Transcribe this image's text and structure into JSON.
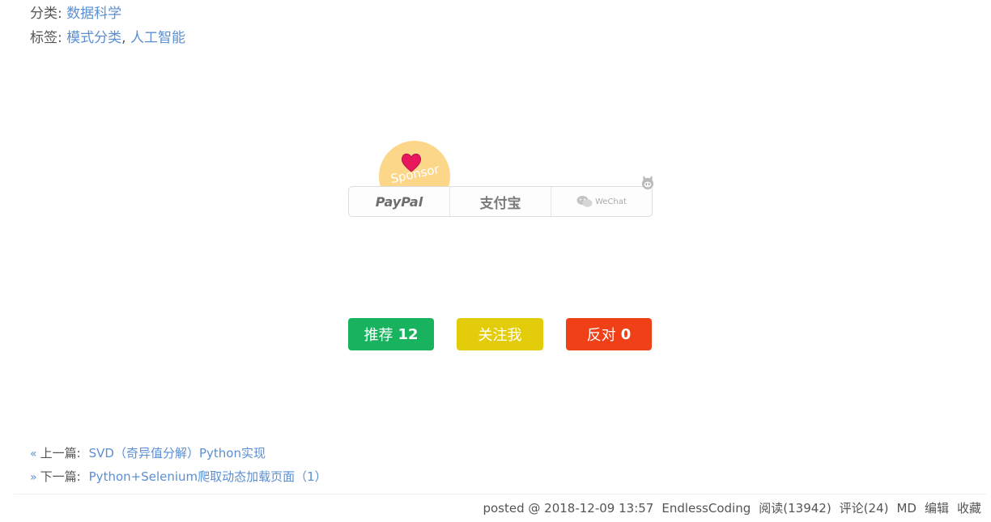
{
  "meta": {
    "category_label": "分类:",
    "category_value": "数据科学",
    "tag_label": "标签:",
    "tag_1": "模式分类",
    "tag_sep": ",",
    "tag_2": "人工智能"
  },
  "sponsor": {
    "badge_text": "Sponsor",
    "paypal": "PayPal",
    "alipay": "支付宝",
    "wechat": "WeChat",
    "heart_color": "#e8175d"
  },
  "votes": {
    "recommend_label": "推荐",
    "recommend_count": "12",
    "follow_label": "关注我",
    "oppose_label": "反对",
    "oppose_count": "0",
    "colors": {
      "recommend": "#19b35f",
      "follow": "#e3cd0b",
      "oppose": "#ef4018"
    }
  },
  "nav": {
    "prev_arrow": "«",
    "prev_label": "上一篇:",
    "prev_title": "SVD（奇异值分解）Python实现",
    "next_arrow": "»",
    "next_label": "下一篇:",
    "next_title": "Python+Selenium爬取动态加载页面（1）"
  },
  "footer": {
    "posted": "posted @ 2018-12-09 13:57",
    "author": "EndlessCoding",
    "reads": "阅读(13942)",
    "comments": "评论(24)",
    "md": "MD",
    "edit": "编辑",
    "favorite": "收藏"
  },
  "theme": {
    "link": "#5b8fd2",
    "text": "#555555"
  }
}
